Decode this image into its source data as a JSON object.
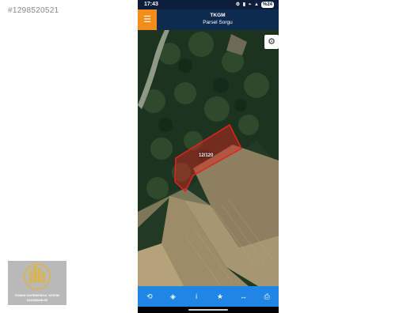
{
  "watermark": {
    "listing_id": "#1298520521"
  },
  "status_bar": {
    "time": "17:43",
    "icons": "⚙ ▮ ⌁ ▲",
    "battery": "%24"
  },
  "app_bar": {
    "title": "TKGM",
    "subtitle": "Parsel Sorgu",
    "menu_icon": "☰"
  },
  "map": {
    "parcel_label": "12/120",
    "settings_icon": "⚙",
    "parcel_color": "#e0231f"
  },
  "toolbar": {
    "items": [
      {
        "name": "refresh-icon",
        "glyph": "⟲"
      },
      {
        "name": "locate-icon",
        "glyph": "◈"
      },
      {
        "name": "info-icon",
        "glyph": "i"
      },
      {
        "name": "star-icon",
        "glyph": "★"
      },
      {
        "name": "measure-icon",
        "glyph": "↔"
      },
      {
        "name": "print-icon",
        "glyph": "⎙"
      }
    ],
    "active_index": 1
  },
  "logo": {
    "line1": "ROBAN GAYRİMENKUL YATIRIM",
    "line2": "DANIŞMANLIĞI"
  },
  "colors": {
    "appbar": "#0d2a4f",
    "accent": "#f28c1b",
    "toolbar": "#1f86e6"
  }
}
